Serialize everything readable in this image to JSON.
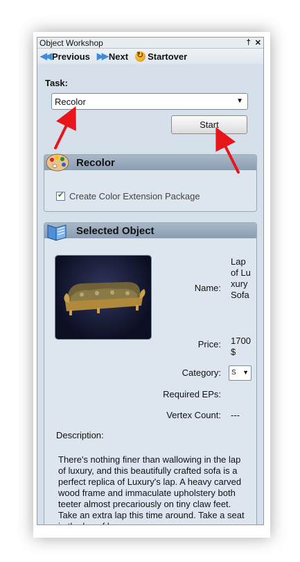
{
  "window": {
    "title": "Object Workshop",
    "pin_glyph": "†",
    "close_glyph": "✕"
  },
  "nav": {
    "previous": "Previous",
    "next": "Next",
    "startover": "Startover",
    "previous_icon": "double-left-arrow-icon",
    "next_icon": "double-right-arrow-icon",
    "startover_icon": "restart-icon"
  },
  "task": {
    "label": "Task:",
    "selected": "Recolor"
  },
  "start_button": "Start",
  "recolor_section": {
    "title": "Recolor",
    "checkbox_label": "Create Color Extension Package",
    "checked": true
  },
  "selected_object": {
    "title": "Selected Object",
    "name_label": "Name:",
    "name_value": "Lap of Luxury Sofa",
    "price_label": "Price:",
    "price_value": "1700 $",
    "category_label": "Category:",
    "category_value": "S",
    "required_eps_label": "Required EPs:",
    "required_eps_value": "",
    "vertex_count_label": "Vertex Count:",
    "vertex_count_value": "---",
    "description_label": "Description:",
    "description_text": "There's nothing finer than wallowing in the lap of luxury, and this beautifully crafted sofa is a perfect replica of Luxury's lap. A heavy carved wood frame and immaculate upholstery both teeter almost precariously on tiny claw feet. Take an extra lap this time around. Take a seat in the lap of luxury."
  },
  "colors": {
    "annotation_arrow": "#e8161a",
    "panel_bg": "#d5e0ea",
    "section_header": "#8b9db2"
  }
}
